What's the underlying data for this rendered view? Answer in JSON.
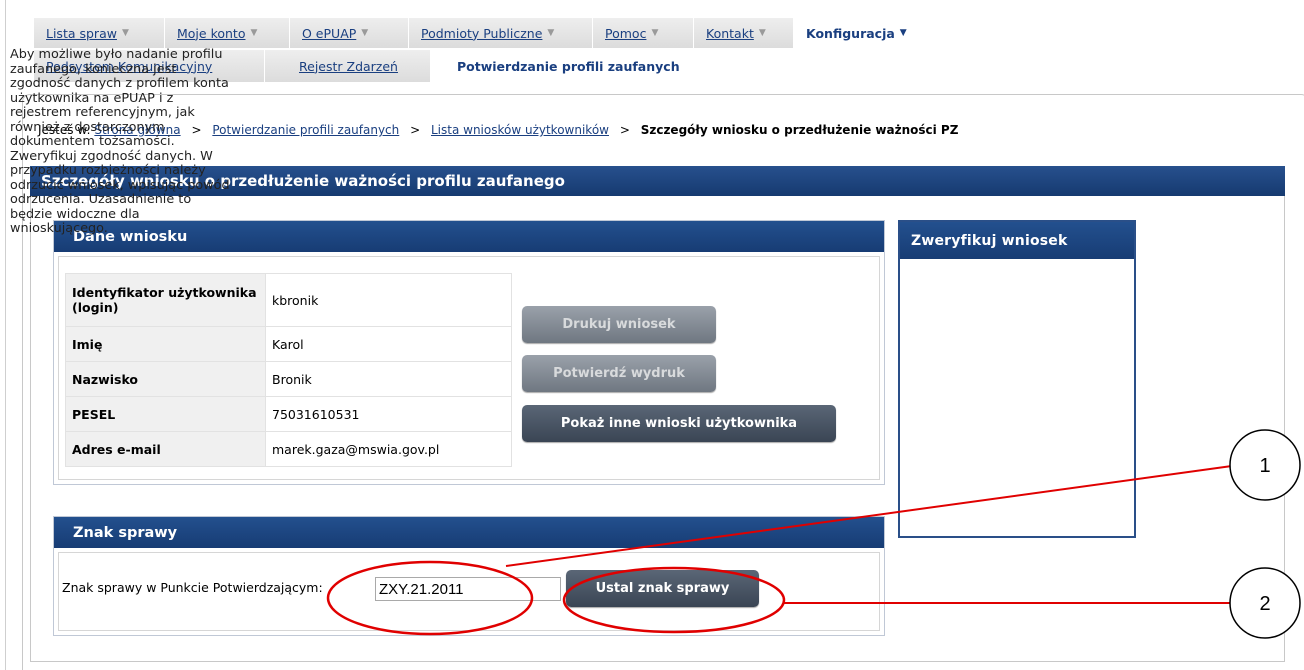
{
  "nav": {
    "main_tabs": [
      {
        "label": "Lista spraw",
        "arrow": "▼"
      },
      {
        "label": "Moje konto",
        "arrow": "▼"
      },
      {
        "label": "O ePUAP",
        "arrow": "▼"
      },
      {
        "label": "Podmioty Publiczne",
        "arrow": "▼"
      },
      {
        "label": "Pomoc",
        "arrow": "▼"
      },
      {
        "label": "Kontakt",
        "arrow": "▼"
      },
      {
        "label": "Konfiguracja",
        "arrow": "▼"
      }
    ],
    "sub_tabs": [
      {
        "label": "Podsystem Komunikacyjny"
      },
      {
        "label": "Rejestr Zdarzeń"
      },
      {
        "label": "Potwierdzanie profili zaufanych"
      }
    ]
  },
  "breadcrumb": {
    "prefix": "Jesteś w:",
    "items": [
      "Strona główna",
      "Potwierdzanie profili zaufanych",
      "Lista wniosków użytkowników"
    ],
    "separator": ">",
    "current": "Szczegóły wniosku o przedłużenie ważności PZ"
  },
  "page": {
    "title": "Szczegóły wniosku o przedłużenie ważności profilu zaufanego"
  },
  "dane_wniosku": {
    "title": "Dane wniosku",
    "rows": [
      {
        "label": "Identyfikator użytkownika (login)",
        "value": "kbronik"
      },
      {
        "label": "Imię",
        "value": "Karol"
      },
      {
        "label": "Nazwisko",
        "value": "Bronik"
      },
      {
        "label": "PESEL",
        "value": "75031610531"
      },
      {
        "label": "Adres e-mail",
        "value": "marek.gaza@mswia.gov.pl"
      }
    ],
    "buttons": {
      "print": "Drukuj wniosek",
      "confirm_print": "Potwierdź wydruk",
      "show_other": "Pokaż inne wnioski użytkownika"
    }
  },
  "znak_sprawy": {
    "title": "Znak sprawy",
    "field_label": "Znak sprawy w Punkcie Potwierdzającym:",
    "field_value": "ZXY.21.2011",
    "set_button": "Ustal znak sprawy"
  },
  "weryfikuj": {
    "title": "Zweryfikuj wniosek",
    "text": "Aby możliwe było nadanie profilu zaufanego, konieczna jest zgodność danych z profilem konta użytkownika na ePUAP i z rejestrem referencyjnym, jak również z dostarczonym dokumentem tożsamości. Zweryfikuj zgodność danych. W przypadku rozbieżności należy odrzucić wniosek, wpisując powód odrzucenia. Uzasadnienie to będzie widoczne dla wnioskującego."
  },
  "callouts": [
    "1",
    "2"
  ],
  "colors": {
    "header_blue": "#1f4a86",
    "link_blue": "#1a3f80",
    "annotation_red": "#e00000",
    "button_dark": "#4a5564",
    "button_disabled": "#8a929c"
  }
}
